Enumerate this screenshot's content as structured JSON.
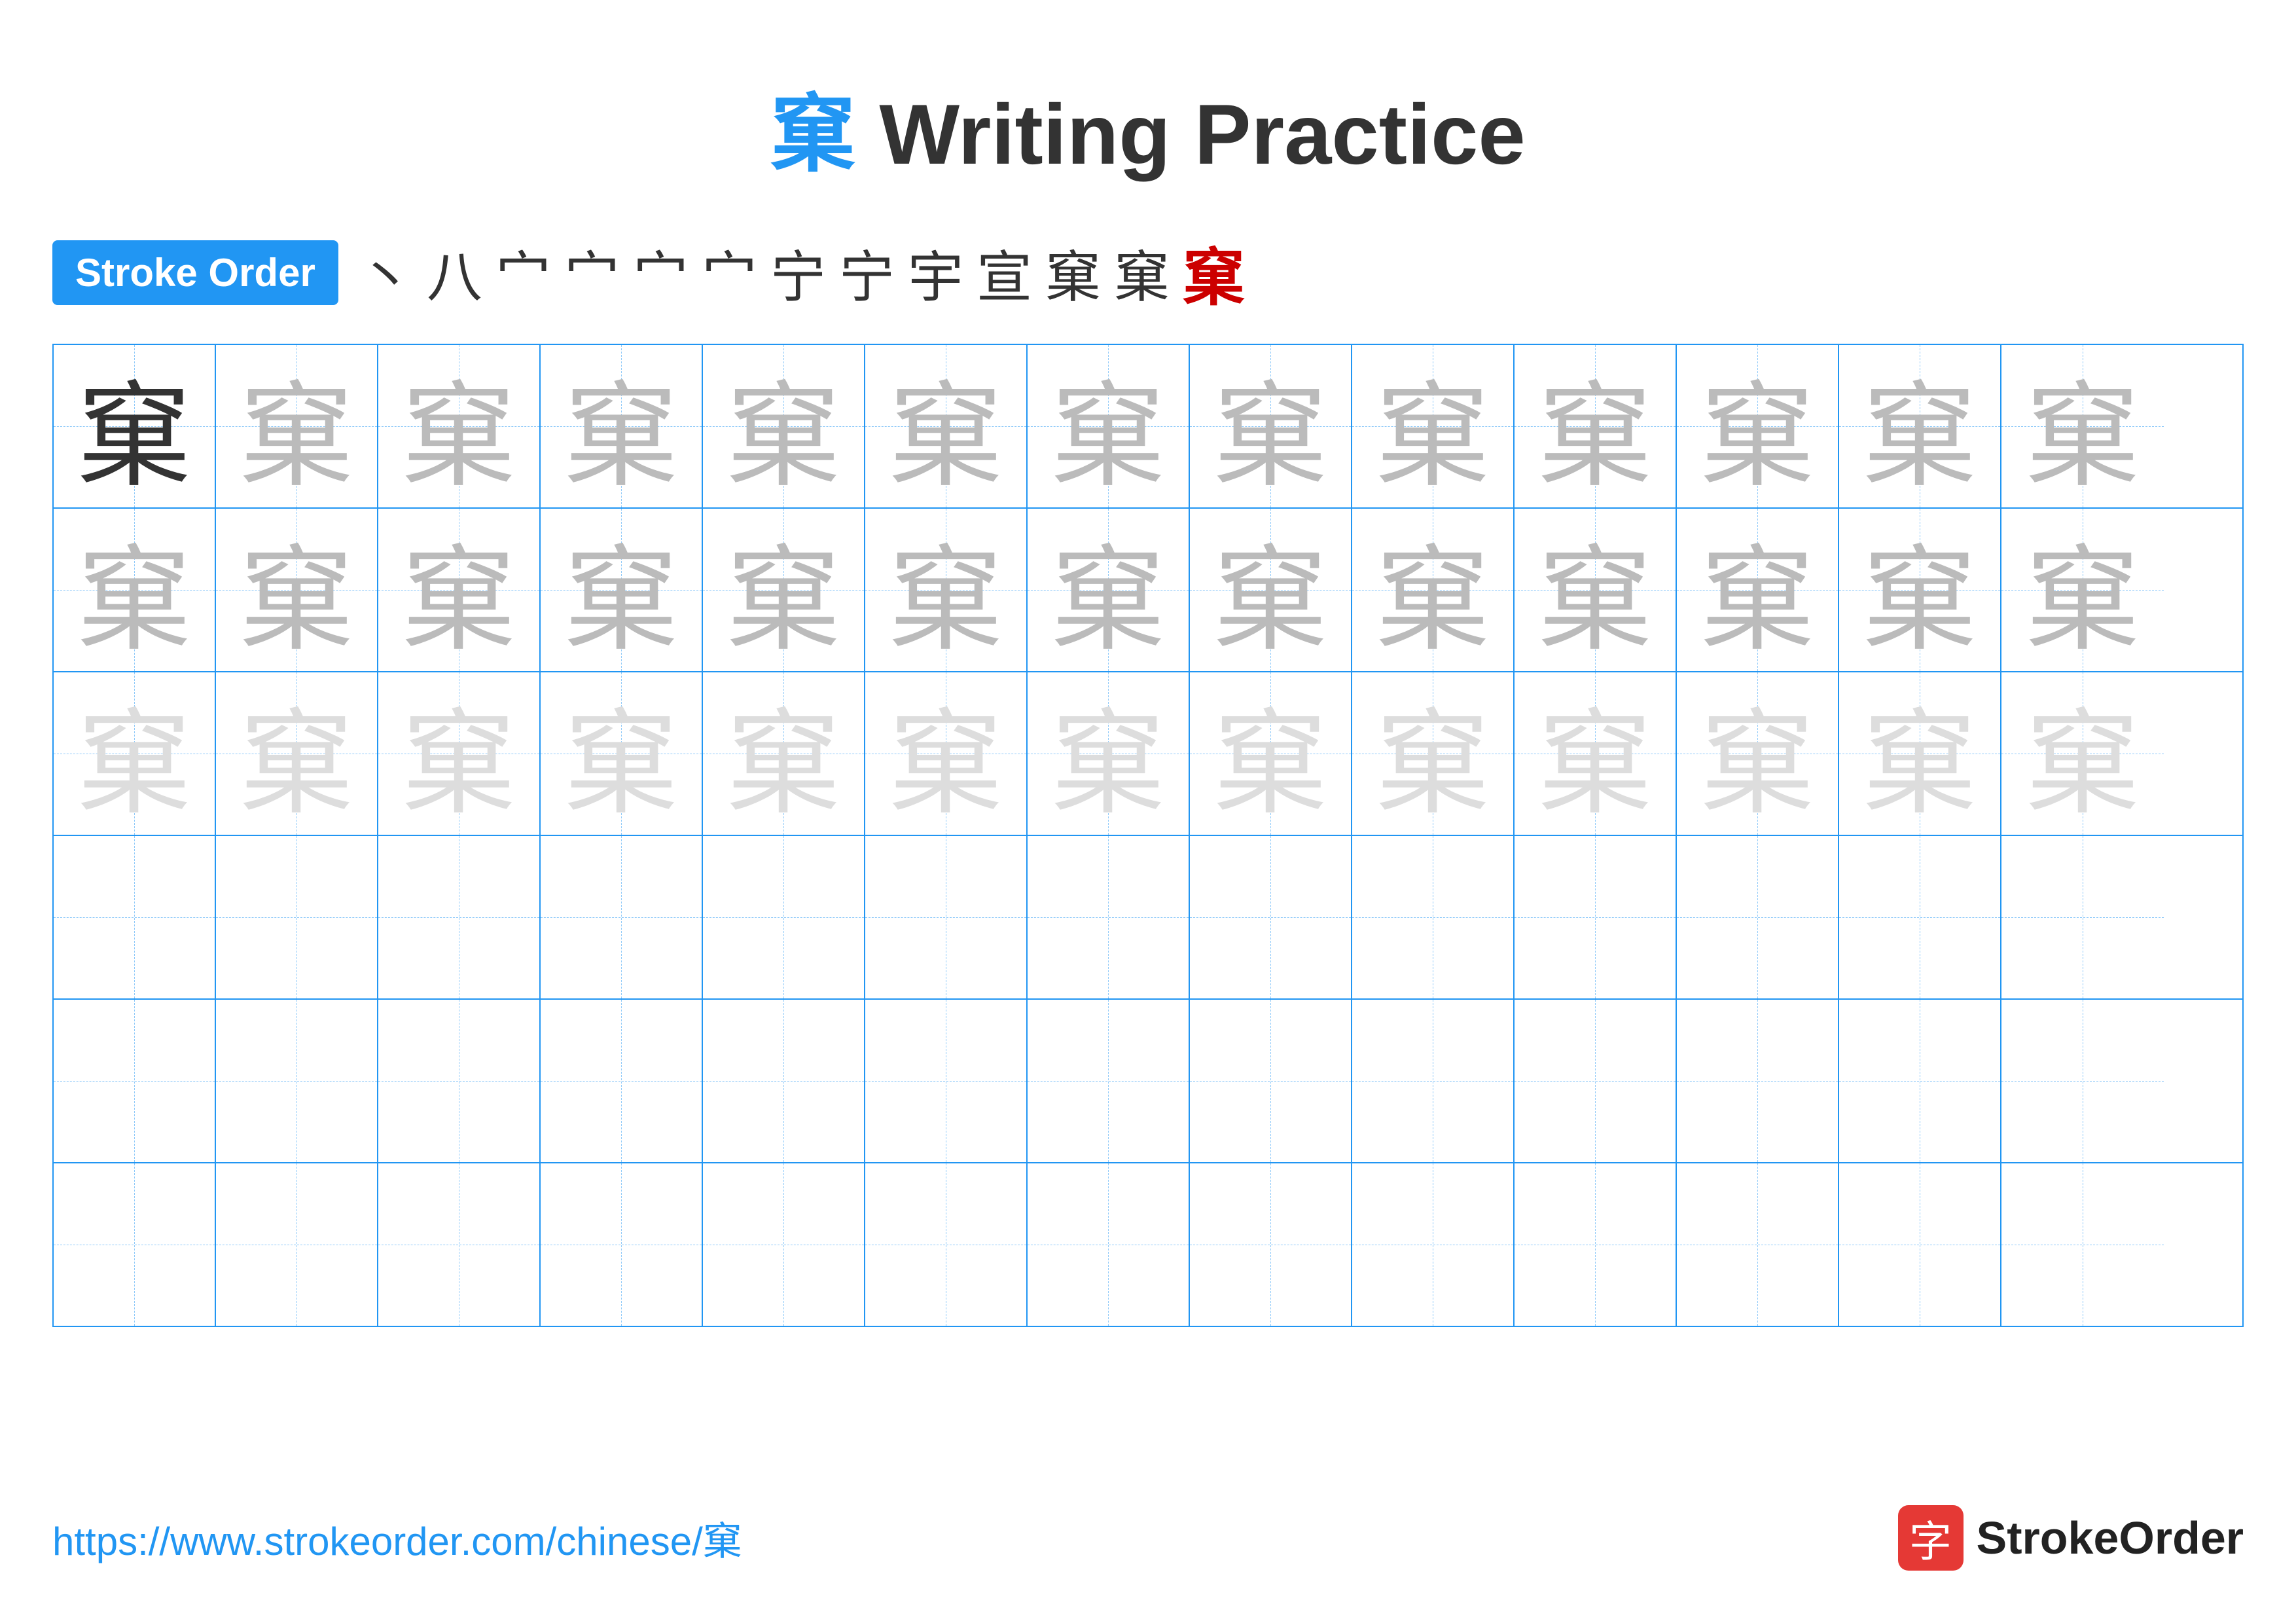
{
  "title": {
    "char": "窠",
    "text": " Writing Practice"
  },
  "stroke_order": {
    "badge": "Stroke Order",
    "chars": [
      "丶",
      "八",
      "宀",
      "宀",
      "宀",
      "宀",
      "宁",
      "宁",
      "宇",
      "宣",
      "窠",
      "窠",
      "窠"
    ]
  },
  "grid": {
    "rows": 6,
    "cols": 13,
    "char": "窠",
    "row_styles": [
      [
        "dark",
        "medium",
        "medium",
        "medium",
        "medium",
        "medium",
        "medium",
        "medium",
        "medium",
        "medium",
        "medium",
        "medium",
        "medium"
      ],
      [
        "medium",
        "medium",
        "medium",
        "medium",
        "medium",
        "medium",
        "medium",
        "medium",
        "medium",
        "medium",
        "medium",
        "medium",
        "medium"
      ],
      [
        "light",
        "light",
        "light",
        "light",
        "light",
        "light",
        "light",
        "light",
        "light",
        "light",
        "light",
        "light",
        "light"
      ],
      [
        "empty",
        "empty",
        "empty",
        "empty",
        "empty",
        "empty",
        "empty",
        "empty",
        "empty",
        "empty",
        "empty",
        "empty",
        "empty"
      ],
      [
        "empty",
        "empty",
        "empty",
        "empty",
        "empty",
        "empty",
        "empty",
        "empty",
        "empty",
        "empty",
        "empty",
        "empty",
        "empty"
      ],
      [
        "empty",
        "empty",
        "empty",
        "empty",
        "empty",
        "empty",
        "empty",
        "empty",
        "empty",
        "empty",
        "empty",
        "empty",
        "empty"
      ]
    ]
  },
  "footer": {
    "url": "https://www.strokeorder.com/chinese/窠",
    "logo_char": "字",
    "logo_text": "StrokeOrder"
  }
}
